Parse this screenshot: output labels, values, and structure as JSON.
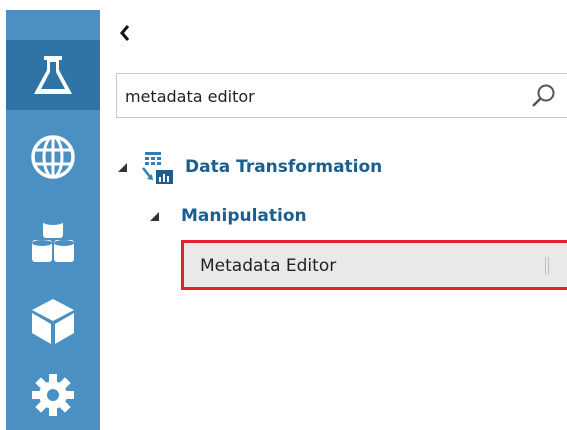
{
  "search": {
    "value": "metadata editor"
  },
  "rail": {
    "items": [
      "experiments-flask-icon",
      "web-services-globe-icon",
      "datasets-cylinders-icon",
      "trained-models-cube-icon",
      "settings-gear-icon"
    ]
  },
  "tree": {
    "category_label": "Data Transformation",
    "subcategory_label": "Manipulation",
    "module_label": "Metadata Editor"
  },
  "colors": {
    "rail": "#4b90c3",
    "rail_active": "#2f74a7",
    "tree_label": "#1b5f91",
    "highlight_border": "#e3202f"
  }
}
